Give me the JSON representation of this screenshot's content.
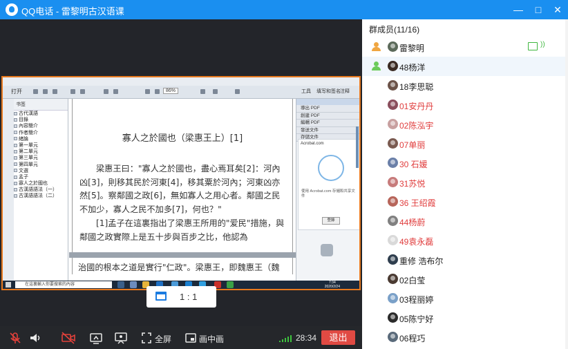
{
  "window": {
    "title": "QQ电话 - 雷黎明古汉语课",
    "controls": {
      "minimize": "—",
      "maximize": "□",
      "close": "✕"
    }
  },
  "shared_screen": {
    "menubar_text": "",
    "toolbar": {
      "open_label": "打开",
      "zoom_value": "86%",
      "tools_label": "工具",
      "fill_sign_label": "填写和签名",
      "comment_label": "注释"
    },
    "bookmarks_title": "书签",
    "bookmarks": [
      "古代漢語",
      "目錄",
      "內容簡介",
      "作者簡介",
      "緒論",
      "第一單元",
      "第二單元",
      "第三單元",
      "第四單元",
      "文選",
      "孟子",
      "寡人之於國也",
      "古漢語語法（一）",
      "古漢語語法（二）"
    ],
    "document": {
      "title": "寡人之於國也（梁惠王上）[1]",
      "paragraph1": "梁惠王曰：\"寡人之於國也，盡心焉耳矣[2]：河內凶[3]，則移其民於河東[4]，移其粟於河內；河東凶亦然[5]。察鄰國之政[6]，無如寡人之用心者。鄰國之民不加少，寡人之民不加多[7]，何也？\"",
      "paragraph2": "[1]孟子在這裏指出了梁惠王所用的\"爱民\"措施，與鄰國之政實際上是五十步與百步之比，他認為",
      "next_page_line": "治國的根本之道是實行\"仁政\"。梁惠王，即魏惠王（魏"
    },
    "right_panel": {
      "items": [
        "導出 PDF",
        "創建 PDF",
        "編輯 PDF",
        "發送文件",
        "存儲文件"
      ],
      "brand": "Acrobat.com",
      "card_text": "使用 Acrobat.com 存儲和共享文件",
      "card_button": "登錄"
    },
    "taskbar": {
      "search_placeholder": "在這裏輸入你要搜索的內容",
      "time": "7:34",
      "date": "2020/2/24"
    }
  },
  "view_ratio": {
    "label": "1 : 1"
  },
  "call_controls": {
    "fullscreen_label": "全屏",
    "pip_label": "画中画",
    "call_time": "28:34",
    "exit_label": "退出",
    "signal_bars": 5
  },
  "members": {
    "title": "群成员(11/16)",
    "list": [
      {
        "name": "雷黎明",
        "role": "owner",
        "color": "normal",
        "avatar": "#5c6a5a",
        "sharing": true
      },
      {
        "name": "48杨洋",
        "role": "speaker",
        "color": "normal",
        "avatar": "#3a2a22",
        "sharing": false
      },
      {
        "name": "18李思聪",
        "role": "",
        "color": "normal",
        "avatar": "#6b5248",
        "sharing": false
      },
      {
        "name": "01安丹丹",
        "role": "",
        "color": "red",
        "avatar": "#8a4e5c",
        "sharing": false
      },
      {
        "name": "02陈泓宇",
        "role": "",
        "color": "red",
        "avatar": "#c8a0a0",
        "sharing": false
      },
      {
        "name": "07单丽",
        "role": "",
        "color": "red",
        "avatar": "#7a5a50",
        "sharing": false
      },
      {
        "name": "30 石媛",
        "role": "",
        "color": "red",
        "avatar": "#6a7fa8",
        "sharing": false
      },
      {
        "name": "31苏悦",
        "role": "",
        "color": "red",
        "avatar": "#c77b7b",
        "sharing": false
      },
      {
        "name": "36 王绍霞",
        "role": "",
        "color": "red",
        "avatar": "#b7655a",
        "sharing": false
      },
      {
        "name": "44杨蔚",
        "role": "",
        "color": "red",
        "avatar": "#808080",
        "sharing": false
      },
      {
        "name": "49袁永磊",
        "role": "",
        "color": "red",
        "avatar": "#d9d9d9",
        "sharing": false
      },
      {
        "name": "重修 浩布尔",
        "role": "",
        "color": "normal",
        "avatar": "#2f3e4e",
        "sharing": false
      },
      {
        "name": "02白莹",
        "role": "",
        "color": "normal",
        "avatar": "#4a3a32",
        "sharing": false
      },
      {
        "name": "03程丽婷",
        "role": "",
        "color": "normal",
        "avatar": "#7aa0c8",
        "sharing": false
      },
      {
        "name": "05陈宁好",
        "role": "",
        "color": "normal",
        "avatar": "#2b2b2b",
        "sharing": false
      },
      {
        "name": "06程巧",
        "role": "",
        "color": "normal",
        "avatar": "#5a6a7a",
        "sharing": false
      }
    ]
  },
  "colors": {
    "title_bar": "#1a8ff0",
    "exit_button": "#e04a43",
    "share_border": "#e8791e",
    "red_name": "#e03c3c",
    "active_green": "#3eb63e"
  }
}
